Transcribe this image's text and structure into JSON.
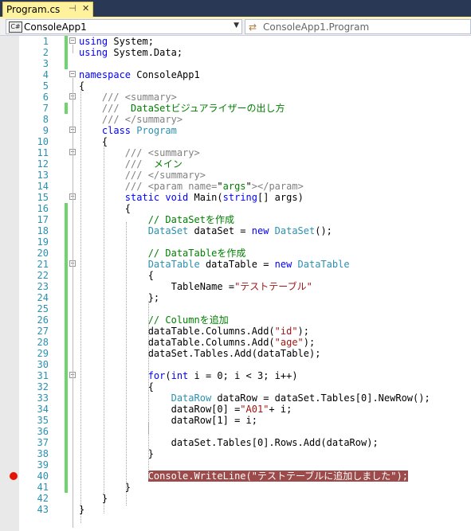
{
  "tab": {
    "title": "Program.cs",
    "pin_icon": "⊣",
    "close_icon": "✕"
  },
  "nav": {
    "left_combo": {
      "icon_text": "C#",
      "value": "ConsoleApp1"
    },
    "right_combo": {
      "value": "ConsoleApp1.Program"
    }
  },
  "colors": {
    "keyword": "#0000ff",
    "type": "#2b91af",
    "string": "#a31515",
    "comment": "#008000",
    "breakpoint": "#e51400",
    "highlight": "#9c4a4a",
    "changed": "#6ed46e"
  },
  "breakpoint_line": 40,
  "lines": [
    {
      "n": "1",
      "fold": "−",
      "chg": true,
      "t": [
        [
          "kw",
          "using"
        ],
        [
          "",
          "System;"
        ]
      ]
    },
    {
      "n": "2",
      "chg": true,
      "t": [
        [
          "kw",
          "using"
        ],
        [
          "",
          "System.Data;"
        ]
      ]
    },
    {
      "n": "3",
      "chg": true,
      "t": []
    },
    {
      "n": "4",
      "fold": "−",
      "t": [
        [
          "kw",
          "namespace"
        ],
        [
          "",
          "ConsoleApp1"
        ]
      ]
    },
    {
      "n": "5",
      "t": [
        [
          "",
          "{"
        ]
      ]
    },
    {
      "n": "6",
      "fold": "−",
      "t": [
        [
          "doc",
          "    /// <summary>"
        ]
      ]
    },
    {
      "n": "7",
      "chg": true,
      "t": [
        [
          "doc",
          "    ///"
        ],
        [
          "cmt",
          " DataSetビジュアライザーの出し方"
        ]
      ]
    },
    {
      "n": "8",
      "t": [
        [
          "doc",
          "    /// </summary>"
        ]
      ]
    },
    {
      "n": "9",
      "fold": "−",
      "t": [
        [
          "kw",
          "    class"
        ],
        [
          "ty",
          "Program"
        ]
      ]
    },
    {
      "n": "10",
      "t": [
        [
          "",
          "    {"
        ]
      ]
    },
    {
      "n": "11",
      "fold": "−",
      "t": [
        [
          "doc",
          "        /// <summary>"
        ]
      ]
    },
    {
      "n": "12",
      "t": [
        [
          "doc",
          "        ///"
        ],
        [
          "cmt",
          " メイン"
        ]
      ]
    },
    {
      "n": "13",
      "t": [
        [
          "doc",
          "        /// </summary>"
        ]
      ]
    },
    {
      "n": "14",
      "t": [
        [
          "doc",
          "        /// <param name="
        ],
        [
          "",
          "\""
        ],
        [
          "cmt",
          "args"
        ],
        [
          "",
          "\""
        ],
        [
          "doc",
          "></param>"
        ]
      ]
    },
    {
      "n": "15",
      "fold": "−",
      "t": [
        [
          "kw",
          "        static void"
        ],
        [
          "",
          "Main("
        ],
        [
          "kw",
          "string"
        ],
        [
          "",
          "[] args)"
        ]
      ]
    },
    {
      "n": "16",
      "chg": true,
      "t": [
        [
          "",
          "        {"
        ]
      ]
    },
    {
      "n": "17",
      "chg": true,
      "t": [
        [
          "cmt",
          "            // DataSetを作成"
        ]
      ]
    },
    {
      "n": "18",
      "chg": true,
      "t": [
        [
          "ty",
          "            DataSet"
        ],
        [
          "",
          "dataSet ="
        ],
        [
          "kw",
          "new"
        ],
        [
          "ty",
          "DataSet"
        ],
        [
          "",
          "();"
        ]
      ]
    },
    {
      "n": "19",
      "chg": true,
      "t": []
    },
    {
      "n": "20",
      "chg": true,
      "t": [
        [
          "cmt",
          "            // DataTableを作成"
        ]
      ]
    },
    {
      "n": "21",
      "chg": true,
      "fold": "−",
      "t": [
        [
          "ty",
          "            DataTable"
        ],
        [
          "",
          "dataTable ="
        ],
        [
          "kw",
          "new"
        ],
        [
          "ty",
          "DataTable"
        ]
      ]
    },
    {
      "n": "22",
      "chg": true,
      "t": [
        [
          "",
          "            {"
        ]
      ]
    },
    {
      "n": "23",
      "chg": true,
      "t": [
        [
          "",
          "                TableName ="
        ],
        [
          "str",
          "\"テストテーブル\""
        ]
      ]
    },
    {
      "n": "24",
      "chg": true,
      "t": [
        [
          "",
          "            };"
        ]
      ]
    },
    {
      "n": "25",
      "chg": true,
      "t": []
    },
    {
      "n": "26",
      "chg": true,
      "t": [
        [
          "cmt",
          "            // Columnを追加"
        ]
      ]
    },
    {
      "n": "27",
      "chg": true,
      "t": [
        [
          "",
          "            dataTable.Columns.Add("
        ],
        [
          "str",
          "\"id\""
        ],
        [
          "",
          ");"
        ]
      ]
    },
    {
      "n": "28",
      "chg": true,
      "t": [
        [
          "",
          "            dataTable.Columns.Add("
        ],
        [
          "str",
          "\"age\""
        ],
        [
          "",
          ");"
        ]
      ]
    },
    {
      "n": "29",
      "chg": true,
      "t": [
        [
          "",
          "            dataSet.Tables.Add(dataTable);"
        ]
      ]
    },
    {
      "n": "30",
      "chg": true,
      "t": []
    },
    {
      "n": "31",
      "chg": true,
      "fold": "−",
      "t": [
        [
          "kw",
          "            for"
        ],
        [
          "",
          "("
        ],
        [
          "kw",
          "int"
        ],
        [
          "",
          "i = 0; i < 3; i++)"
        ]
      ]
    },
    {
      "n": "32",
      "chg": true,
      "t": [
        [
          "",
          "            {"
        ]
      ]
    },
    {
      "n": "33",
      "chg": true,
      "t": [
        [
          "ty",
          "                DataRow"
        ],
        [
          "",
          "dataRow = dataSet.Tables[0].NewRow();"
        ]
      ]
    },
    {
      "n": "34",
      "chg": true,
      "t": [
        [
          "",
          "                dataRow[0] ="
        ],
        [
          "str",
          "\"A01\""
        ],
        [
          "",
          "+ i;"
        ]
      ]
    },
    {
      "n": "35",
      "chg": true,
      "t": [
        [
          "",
          "                dataRow[1] = i;"
        ]
      ]
    },
    {
      "n": "36",
      "chg": true,
      "t": []
    },
    {
      "n": "37",
      "chg": true,
      "t": [
        [
          "",
          "                dataSet.Tables[0].Rows.Add(dataRow);"
        ]
      ]
    },
    {
      "n": "38",
      "chg": true,
      "t": [
        [
          "",
          "            }"
        ]
      ]
    },
    {
      "n": "39",
      "chg": true,
      "t": []
    },
    {
      "n": "40",
      "chg": true,
      "bp": true,
      "t": [
        [
          "",
          "            "
        ],
        [
          "hl",
          "Console.WriteLine(\"テストテーブルに追加しました\");"
        ]
      ]
    },
    {
      "n": "41",
      "chg": true,
      "t": [
        [
          "",
          "        }"
        ]
      ]
    },
    {
      "n": "42",
      "t": [
        [
          "",
          "    }"
        ]
      ]
    },
    {
      "n": "43",
      "t": [
        [
          "",
          "}"
        ]
      ]
    }
  ]
}
